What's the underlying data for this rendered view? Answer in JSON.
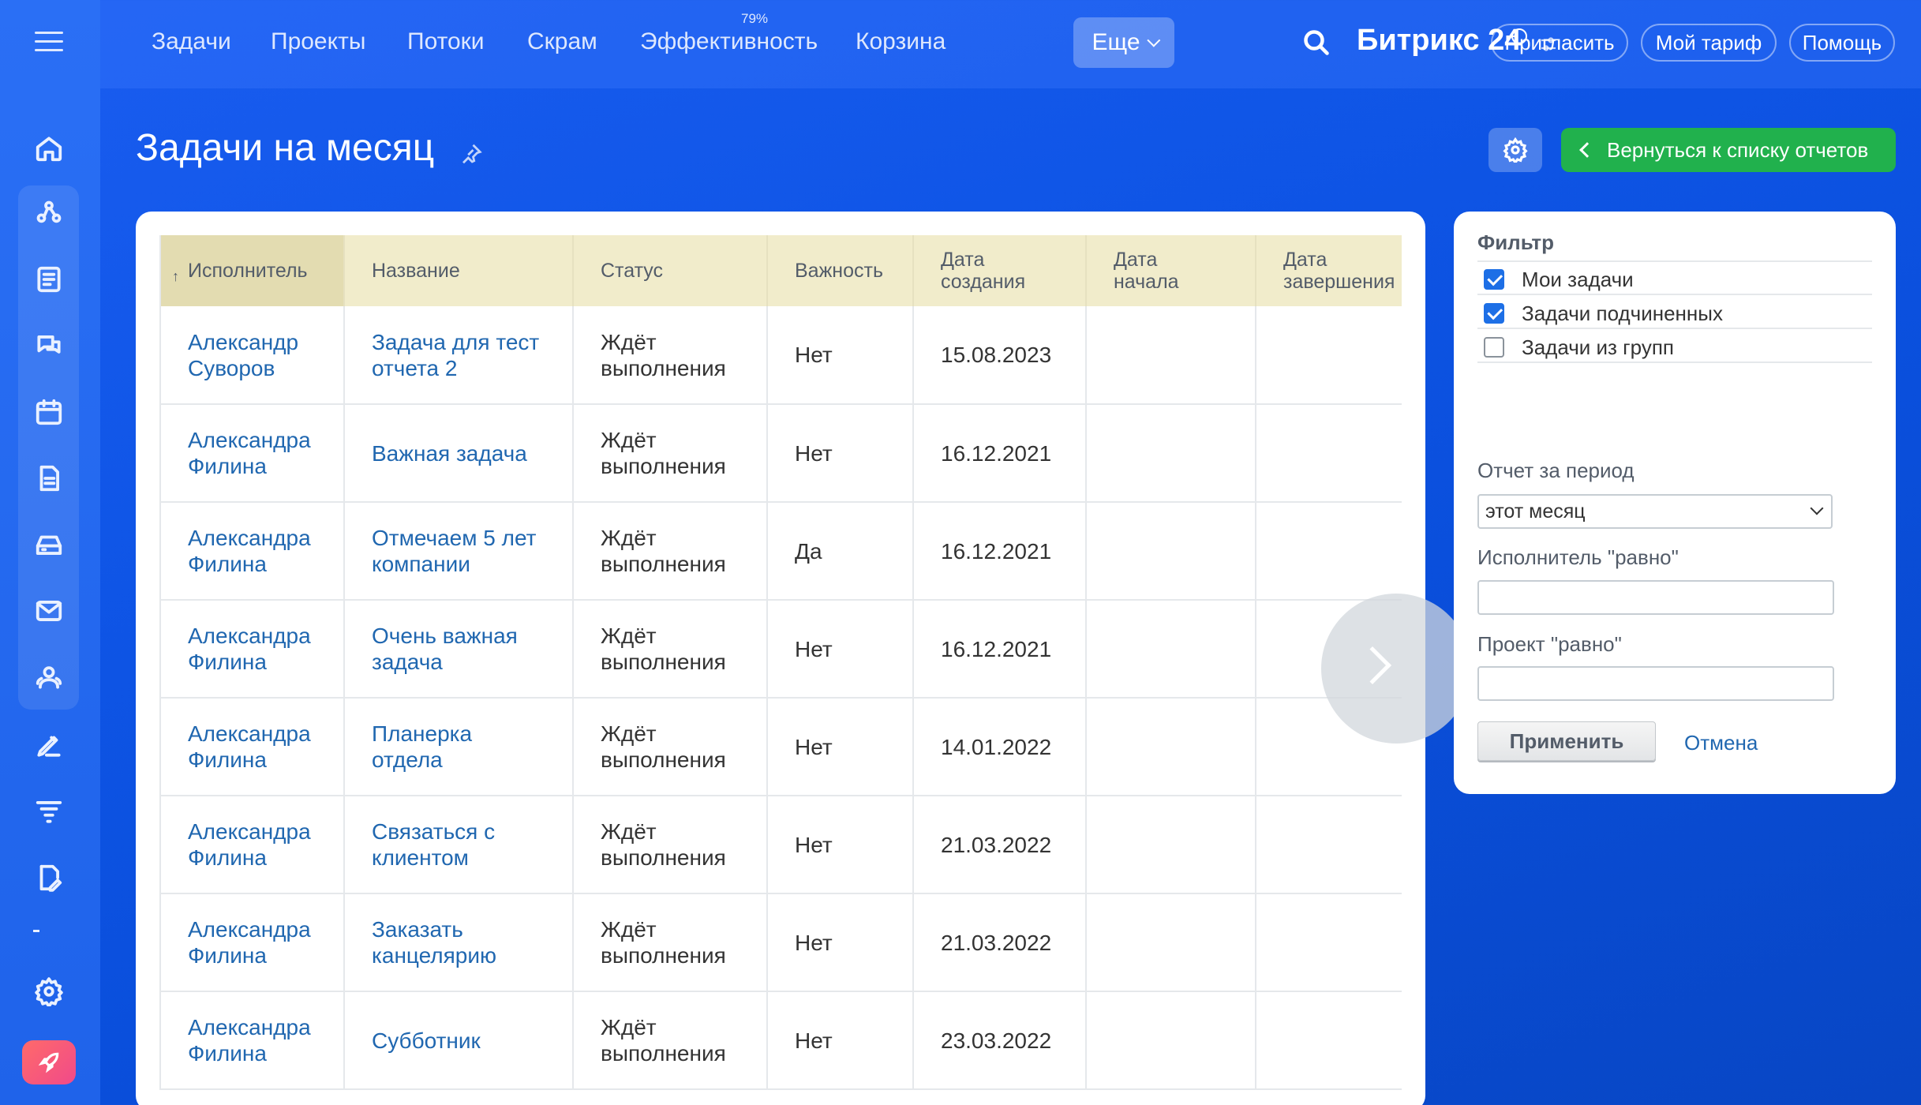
{
  "topnav": {
    "items": [
      "Задачи",
      "Проекты",
      "Потоки",
      "Скрам",
      "Эффективность",
      "Корзина"
    ],
    "efficiency_badge": "79%",
    "more_label": "Еще",
    "brand": "Битрикс 24",
    "invite_label": "Пригласить",
    "tariff_label": "Мой тариф",
    "help_label": "Помощь"
  },
  "page": {
    "title": "Задачи на месяц",
    "back_label": "Вернуться к списку отчетов"
  },
  "table": {
    "columns": [
      "Исполнитель",
      "Название",
      "Статус",
      "Важность",
      "Дата\nсоздания",
      "Дата\nначала",
      "Дата\nзавершения"
    ],
    "rows": [
      {
        "assignee": "Александр Суворов",
        "name": "Задача для тест отчета 2",
        "status": "Ждёт выполнения",
        "priority": "Нет",
        "created": "15.08.2023",
        "start": "",
        "end": ""
      },
      {
        "assignee": "Александра Филина",
        "name": "Важная задача",
        "status": "Ждёт выполнения",
        "priority": "Нет",
        "created": "16.12.2021",
        "start": "",
        "end": ""
      },
      {
        "assignee": "Александра Филина",
        "name": "Отмечаем 5 лет компании",
        "status": "Ждёт выполнения",
        "priority": "Да",
        "created": "16.12.2021",
        "start": "",
        "end": ""
      },
      {
        "assignee": "Александра Филина",
        "name": "Очень важная задача",
        "status": "Ждёт выполнения",
        "priority": "Нет",
        "created": "16.12.2021",
        "start": "",
        "end": ""
      },
      {
        "assignee": "Александра Филина",
        "name": "Планерка отдела",
        "status": "Ждёт выполнения",
        "priority": "Нет",
        "created": "14.01.2022",
        "start": "",
        "end": ""
      },
      {
        "assignee": "Александра Филина",
        "name": "Связаться с клиентом",
        "status": "Ждёт выполнения",
        "priority": "Нет",
        "created": "21.03.2022",
        "start": "",
        "end": ""
      },
      {
        "assignee": "Александра Филина",
        "name": "Заказать канцелярию",
        "status": "Ждёт выполнения",
        "priority": "Нет",
        "created": "21.03.2022",
        "start": "",
        "end": ""
      },
      {
        "assignee": "Александра Филина",
        "name": "Субботник",
        "status": "Ждёт выполнения",
        "priority": "Нет",
        "created": "23.03.2022",
        "start": "",
        "end": ""
      }
    ]
  },
  "filter": {
    "title": "Фильтр",
    "checkboxes": [
      {
        "label": "Мои задачи",
        "checked": true
      },
      {
        "label": "Задачи подчиненных",
        "checked": true
      },
      {
        "label": "Задачи из групп",
        "checked": false
      }
    ],
    "period_label": "Отчет за период",
    "period_value": "этот месяц",
    "assignee_label": "Исполнитель \"равно\"",
    "assignee_value": "",
    "project_label": "Проект \"равно\"",
    "project_value": "",
    "apply_label": "Применить",
    "cancel_label": "Отмена"
  },
  "colors": {
    "accent_green": "#21b14d",
    "link_blue": "#2067b0",
    "header_bg": "#f1eccb"
  }
}
